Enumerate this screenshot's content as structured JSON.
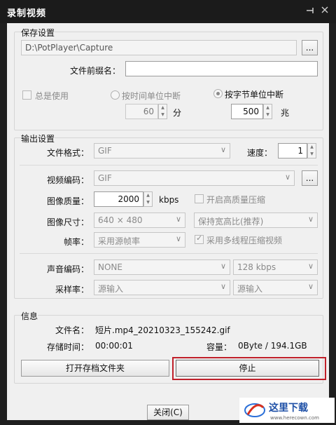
{
  "window": {
    "title": "录制视频",
    "pin_icon": "pin-icon",
    "close_icon": "close-icon"
  },
  "save": {
    "group_title": "保存设置",
    "path": "D:\\PotPlayer\\Capture",
    "browse_label": "...",
    "prefix_label": "文件前缀名：",
    "prefix_value": "",
    "always_use_label": "总是使用",
    "always_use_checked": false,
    "by_time_label": "按时间单位中断",
    "by_time_selected": false,
    "by_size_label": "按字节单位中断",
    "by_size_selected": true,
    "time_value": "60",
    "time_unit": "分",
    "size_value": "500",
    "size_unit": "兆"
  },
  "output": {
    "group_title": "输出设置",
    "format_label": "文件格式：",
    "format_value": "GIF",
    "speed_label": "速度：",
    "speed_value": "1",
    "video_codec_label": "视频编码：",
    "video_codec_value": "GIF",
    "video_codec_more": "...",
    "quality_label": "图像质量：",
    "quality_value": "2000",
    "quality_unit": "kbps",
    "hq_label": "开启高质量压缩",
    "hq_checked": false,
    "size_label": "图像尺寸：",
    "size_value": "640 × 480",
    "aspect_value": "保持宽高比(推荐)",
    "fps_label": "帧率：",
    "fps_value": "采用源帧率",
    "multithread_label": "采用多线程压缩视频",
    "multithread_checked": true,
    "audio_codec_label": "声音编码：",
    "audio_codec_value": "NONE",
    "audio_bitrate_value": "128 kbps",
    "sample_label": "采样率：",
    "sample_value": "源输入",
    "channel_value": "源输入"
  },
  "info": {
    "group_title": "信息",
    "filename_label": "文件名：",
    "filename_value": "短片.mp4_20210323_155242.gif",
    "time_label": "存储时间：",
    "time_value": "00:00:01",
    "capacity_label": "容量：",
    "capacity_value": "0Byte / 194.1GB",
    "open_folder_label": "打开存档文件夹",
    "stop_label": "停止"
  },
  "footer": {
    "close_label": "关闭(C)"
  },
  "colors": {
    "title_bg": "#1b1b1b",
    "dialog_bg": "#f0f0f0",
    "highlight": "#c0202a"
  }
}
